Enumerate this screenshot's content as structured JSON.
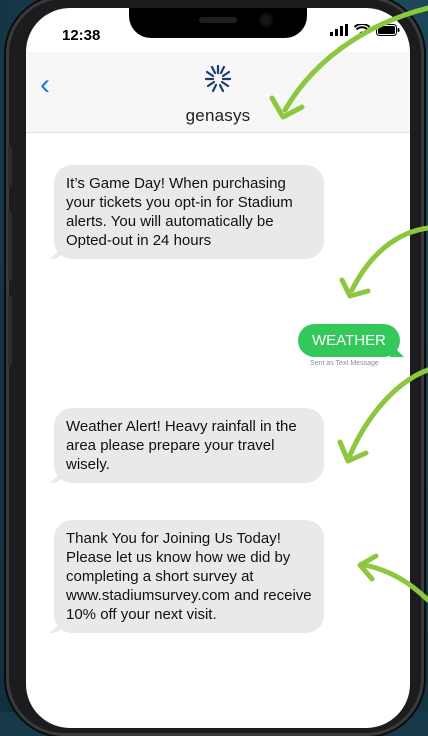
{
  "status_bar": {
    "time": "12:38"
  },
  "header": {
    "brand": "genasys",
    "back_icon": "chevron-left-icon",
    "logo_icon": "genasys-logo"
  },
  "messages": [
    {
      "direction": "incoming",
      "text": "It’s Game Day! When purchasing your tickets you opt-in for Stadium alerts. You will automatically be Opted-out in 24 hours"
    },
    {
      "direction": "outgoing",
      "text": "WEATHER",
      "meta": "Sent as Text Message"
    },
    {
      "direction": "incoming",
      "text": "Weather Alert! Heavy rainfall in the area please prepare your travel wisely."
    },
    {
      "direction": "incoming",
      "text": "Thank You for Joining Us Today! Please let us know how we did by completing a short survey at www.stadiumsurvey.com and receive 10% off your next visit."
    }
  ],
  "colors": {
    "background": "#163a4a",
    "accent_arrow": "#8dc63f",
    "outgoing_bubble": "#34c759",
    "incoming_bubble": "#e9e9eb",
    "link_blue": "#1e74f2"
  }
}
